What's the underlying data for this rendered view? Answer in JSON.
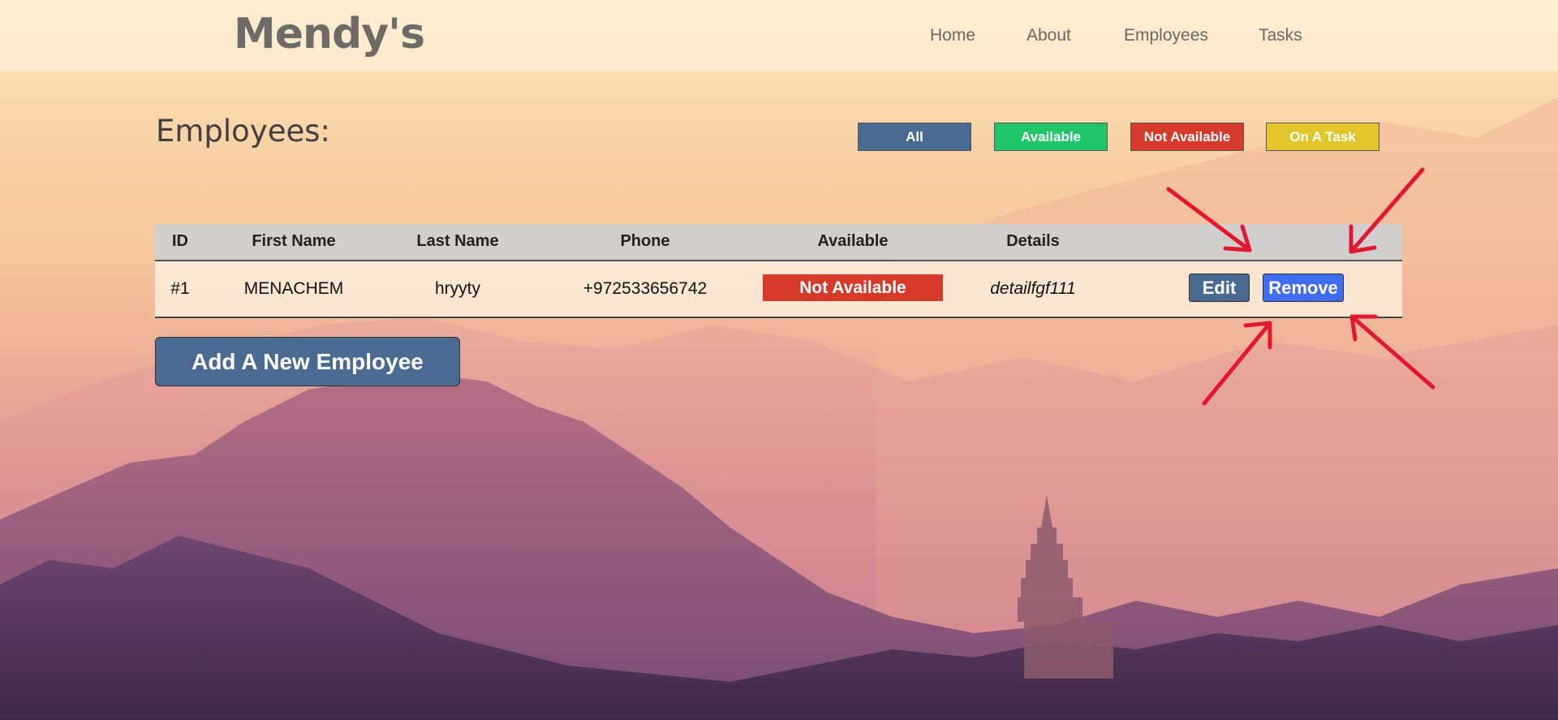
{
  "header": {
    "brand": "Mendy's",
    "nav": [
      "Home",
      "About",
      "Employees",
      "Tasks"
    ]
  },
  "page": {
    "title": "Employees:"
  },
  "filters": [
    {
      "label": "All",
      "color": "#4a6a92"
    },
    {
      "label": "Available",
      "color": "#1fc76a"
    },
    {
      "label": "Not Available",
      "color": "#d63a2a"
    },
    {
      "label": "On A Task",
      "color": "#e3c52c"
    }
  ],
  "table": {
    "headers": [
      "ID",
      "First Name",
      "Last Name",
      "Phone",
      "Available",
      "Details"
    ],
    "rows": [
      {
        "id": "#1",
        "first_name": "MENACHEM",
        "last_name": "hryyty",
        "phone": "+972533656742",
        "available": "Not Available",
        "details": "detailfgf111",
        "edit_label": "Edit",
        "remove_label": "Remove"
      }
    ]
  },
  "add_button": {
    "label": "Add A New Employee"
  },
  "colors": {
    "edit": "#4a6a92",
    "remove": "#3f6cf0",
    "not_available": "#d63a2a",
    "annotation_arrows": "#e3172f"
  }
}
